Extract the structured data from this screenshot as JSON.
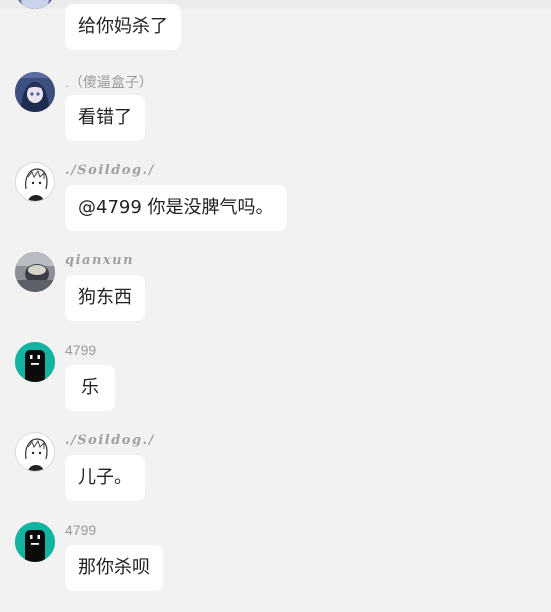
{
  "chat": {
    "messages": [
      {
        "sender": "",
        "text": "给你妈杀了"
      },
      {
        "sender": ".（傻逼盒子）",
        "text": "看错了"
      },
      {
        "sender": "./Soildog./",
        "text": "@4799 你是没脾气吗。"
      },
      {
        "sender": "qianxun",
        "text": "狗东西"
      },
      {
        "sender": "4799",
        "text": "乐"
      },
      {
        "sender": "./Soildog./",
        "text": "儿子。"
      },
      {
        "sender": "4799",
        "text": "那你杀呗"
      }
    ]
  },
  "colors": {
    "background": "#f2f2f2",
    "bubble": "#ffffff",
    "sender_name": "#9a9a9a",
    "avatar_teal": "#13b3a2"
  },
  "icons": {
    "avatar_4799": "robot-face-icon",
    "avatar_soildog": "anime-sketch-icon",
    "avatar_shabi": "anime-girl-icon",
    "avatar_qianxun": "photo-avatar-icon"
  }
}
